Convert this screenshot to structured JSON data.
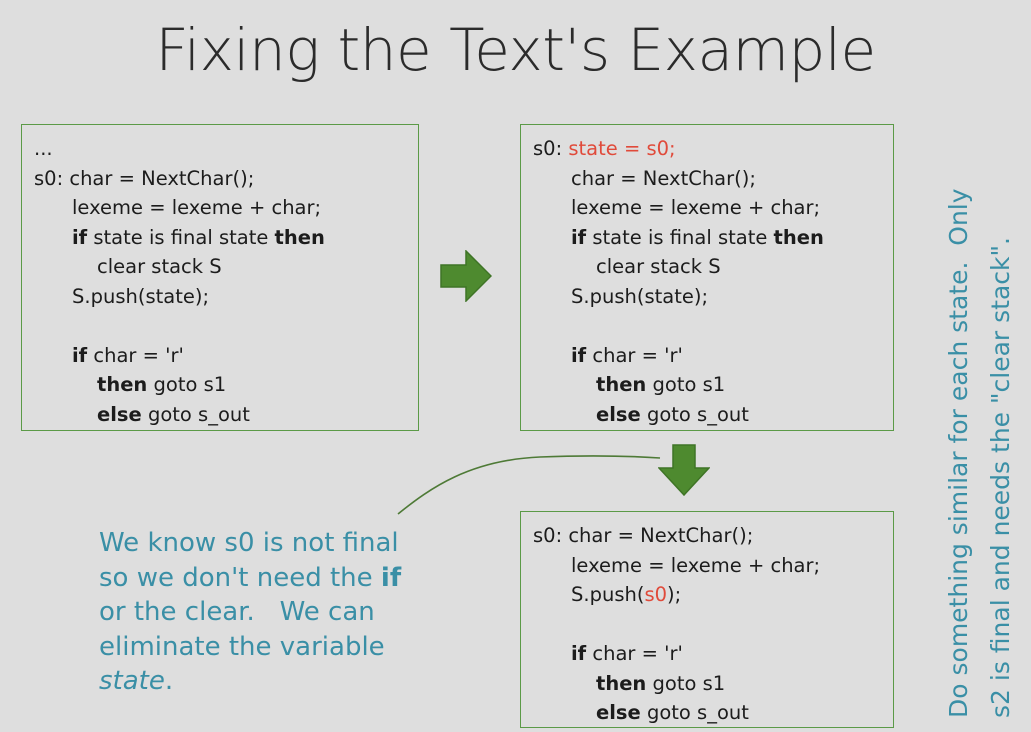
{
  "slide": {
    "title": "Fixing the Text's Example"
  },
  "box_original": {
    "lines": [
      {
        "plain": "..."
      },
      {
        "prefix": "s0: ",
        "plain": "char = NextChar();"
      },
      {
        "plain": "lexeme = lexeme + char;"
      },
      {
        "kw1": "if",
        "mid": " state is final state ",
        "kw2": "then"
      },
      {
        "plain": "clear stack S"
      },
      {
        "plain": "S.push(state);"
      },
      {
        "kw1": "if",
        "rest": " char = 'r'"
      },
      {
        "kw1": "then",
        "rest": " goto s1"
      },
      {
        "kw1": "else",
        "rest": " goto s_out"
      }
    ]
  },
  "box_state": {
    "line1_prefix": "s0: ",
    "line1_red": "state = s0;",
    "lines": [
      {
        "plain": "char = NextChar();"
      },
      {
        "plain": "lexeme = lexeme + char;"
      },
      {
        "kw1": "if",
        "mid": " state is final state ",
        "kw2": "then"
      },
      {
        "plain": "clear stack S"
      },
      {
        "plain": "S.push(state);"
      },
      {
        "kw1": "if",
        "rest": " char = 'r'"
      },
      {
        "kw1": "then",
        "rest": " goto s1"
      },
      {
        "kw1": "else",
        "rest": " goto s_out"
      }
    ]
  },
  "box_final": {
    "line1": "s0: char = NextChar();",
    "line2": "lexeme = lexeme + char;",
    "push_prefix": "S.push(",
    "push_red": "s0",
    "push_suffix": ");",
    "if_kw": "if",
    "if_rest": " char = 'r'",
    "then_kw": "then",
    "then_rest": " goto s1",
    "else_kw": "else",
    "else_rest": " goto s_out"
  },
  "note": {
    "l1": "We know s0 is not final",
    "l2_a": "so we don't need the ",
    "l2_b": "if",
    "l3": "or the clear.   We can",
    "l4": "eliminate the variable",
    "l5_a": "state",
    "l5_b": "."
  },
  "side_note": {
    "l1": "Do something similar for each state.  Only",
    "l2": "s2 is final and needs the \"clear stack\"."
  },
  "colors": {
    "accent_green": "#5b9a47",
    "arrow_green": "#4e8a2f",
    "note_blue": "#3a8fa6",
    "highlight_red": "#e04a3a"
  }
}
